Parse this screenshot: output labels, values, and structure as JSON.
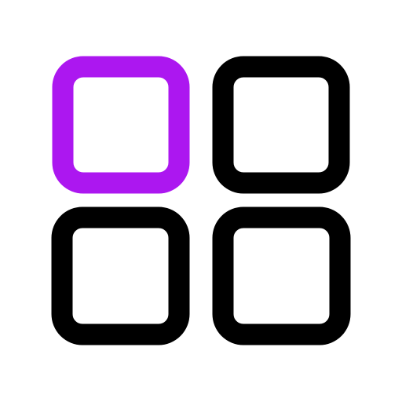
{
  "icon": {
    "name": "grid-apps-icon",
    "tiles": [
      {
        "name": "grid-tile-top-left",
        "color": "#ac17f0",
        "highlighted": true
      },
      {
        "name": "grid-tile-top-right",
        "color": "#000000",
        "highlighted": false
      },
      {
        "name": "grid-tile-bottom-left",
        "color": "#000000",
        "highlighted": false
      },
      {
        "name": "grid-tile-bottom-right",
        "color": "#000000",
        "highlighted": false
      }
    ]
  }
}
